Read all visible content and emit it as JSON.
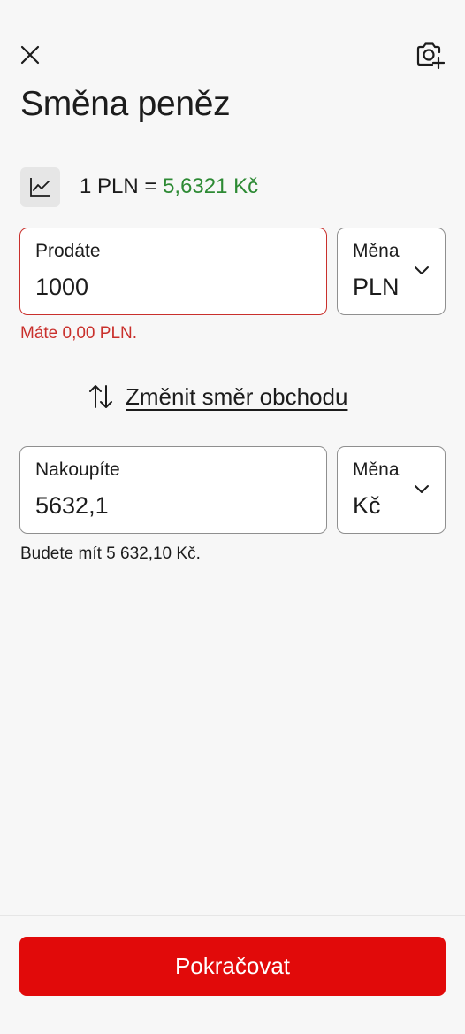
{
  "header": {
    "title": "Směna peněz",
    "close_icon": "close-icon",
    "camera_icon": "camera-add-icon"
  },
  "rate": {
    "chart_icon": "line-chart-icon",
    "base": "1 PLN = ",
    "value": "5,6321 Kč"
  },
  "sell": {
    "label": "Prodáte",
    "value": "1000",
    "currency_label": "Měna",
    "currency_value": "PLN",
    "error": "Máte 0,00 PLN."
  },
  "swap": {
    "icon": "swap-vertical-icon",
    "label": "Změnit směr obchodu"
  },
  "buy": {
    "label": "Nakoupíte",
    "value": "5632,1",
    "currency_label": "Měna",
    "currency_value": "Kč",
    "info": "Budete mít 5 632,10 Kč."
  },
  "footer": {
    "continue_label": "Pokračovat"
  },
  "colors": {
    "accent": "#e10a0a",
    "error": "#c9302c",
    "rate_positive": "#2d8a34",
    "background": "#f7f7f7"
  }
}
